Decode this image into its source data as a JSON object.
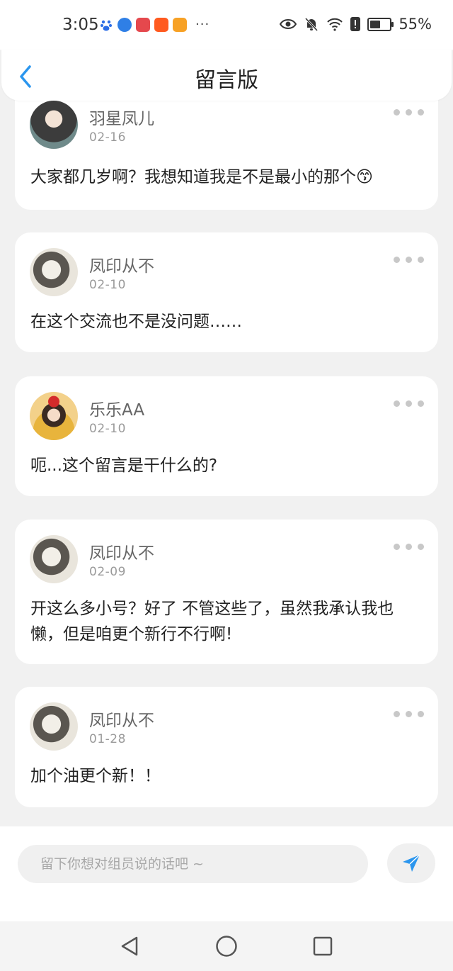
{
  "status_bar": {
    "time": "3:05",
    "battery": "55%",
    "battery_level": 0.55,
    "app_icons": [
      "baidu-icon",
      "browser-icon",
      "app-red-icon",
      "taobao-icon",
      "video-icon"
    ],
    "overflow": "···"
  },
  "header": {
    "title": "留言版"
  },
  "posts": [
    {
      "name": "羽星凤儿",
      "date": "02-16",
      "content": "大家都几岁啊？我想知道我是不是最小的那个😙",
      "avatar": "girl-ink-avatar"
    },
    {
      "name": "凤印从不",
      "date": "02-10",
      "content": "在这个交流也不是没问题……",
      "avatar": "sketch-girl-avatar"
    },
    {
      "name": "乐乐AA",
      "date": "02-10",
      "content": "呃...这个留言是干什么的?",
      "avatar": "red-bow-girl-avatar"
    },
    {
      "name": "凤印从不",
      "date": "02-09",
      "content": "开这么多小号？好了 不管这些了，虽然我承认我也懒，但是咱更个新行不行啊!",
      "avatar": "sketch-girl-avatar"
    },
    {
      "name": "凤印从不",
      "date": "01-28",
      "content": "加个油更个新！！",
      "avatar": "sketch-girl-avatar"
    }
  ],
  "composer": {
    "placeholder": "留下你想对组员说的话吧 ~"
  },
  "colors": {
    "accent": "#2b96ee",
    "background": "#f1f1f1"
  }
}
